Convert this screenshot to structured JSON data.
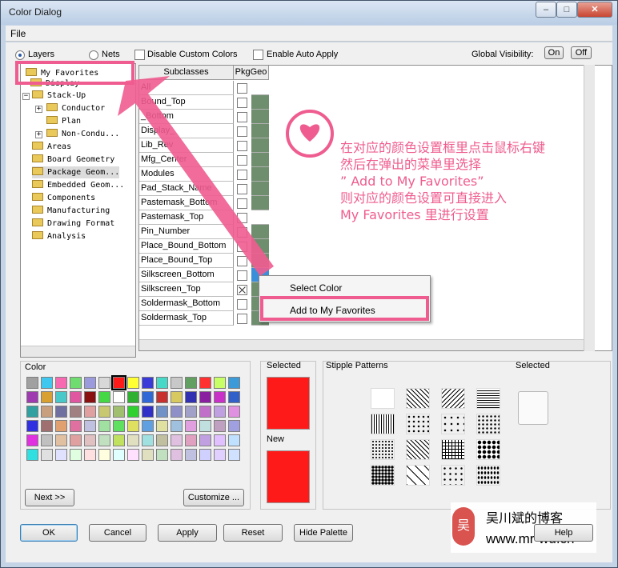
{
  "window": {
    "title": "Color Dialog",
    "minimize": "–",
    "maximize": "□",
    "close": "✕"
  },
  "menu": {
    "file": "File"
  },
  "options": {
    "layers": "Layers",
    "nets": "Nets",
    "disable_custom": "Disable Custom Colors",
    "auto_apply": "Enable Auto Apply",
    "global_visibility": "Global Visibility:",
    "on": "On",
    "off": "Off"
  },
  "tree": [
    {
      "label": "My Favorites"
    },
    {
      "label": "Display"
    },
    {
      "label": "Stack-Up"
    },
    {
      "label": "Conductor"
    },
    {
      "label": "Plan"
    },
    {
      "label": "Non-Condu..."
    },
    {
      "label": "Areas"
    },
    {
      "label": "Board Geometry"
    },
    {
      "label": "Package Geom..."
    },
    {
      "label": "Embedded Geom..."
    },
    {
      "label": "Components"
    },
    {
      "label": "Manufacturing"
    },
    {
      "label": "Drawing Format"
    },
    {
      "label": "Analysis"
    }
  ],
  "grid": {
    "headers": [
      "Subclasses",
      "PkgGeo"
    ],
    "rows": [
      "All",
      "Bound_Top",
      "_Bottom",
      "Display_",
      "Lib_Rev",
      "Mfg_Center",
      "Modules",
      "Pad_Stack_Name",
      "Pastemask_Bottom",
      "Pastemask_Top",
      "Pin_Number",
      "Place_Bound_Bottom",
      "Place_Bound_Top",
      "Silkscreen_Bottom",
      "Silkscreen_Top",
      "Soldermask_Bottom",
      "Soldermask_Top"
    ]
  },
  "context_menu": {
    "select_color": "Select Color",
    "add_favorites": "Add to My Favorites"
  },
  "color": {
    "title": "Color",
    "next": "Next >>",
    "customize": "Customize ..."
  },
  "selected": {
    "title": "Selected",
    "new": "New",
    "color": "#ff1a1a"
  },
  "stipple": {
    "title": "Stipple Patterns",
    "selected": "Selected"
  },
  "buttons": {
    "ok": "OK",
    "cancel": "Cancel",
    "apply": "Apply",
    "reset": "Reset",
    "hide_palette": "Hide Palette",
    "help": "Help"
  },
  "annotation": {
    "line1": "在对应的颜色设置框里点击鼠标右键",
    "line2": "然后在弹出的菜单里选择",
    "line3": "” Add to My Favorites”",
    "line4": "则对应的颜色设置可直接进入",
    "line5": "My Favorites 里进行设置"
  },
  "watermark": {
    "name": "吴川斌的博客",
    "url": "www.mr-wu.cn",
    "logo_char": "吴"
  },
  "accent": "#ef5c8f"
}
